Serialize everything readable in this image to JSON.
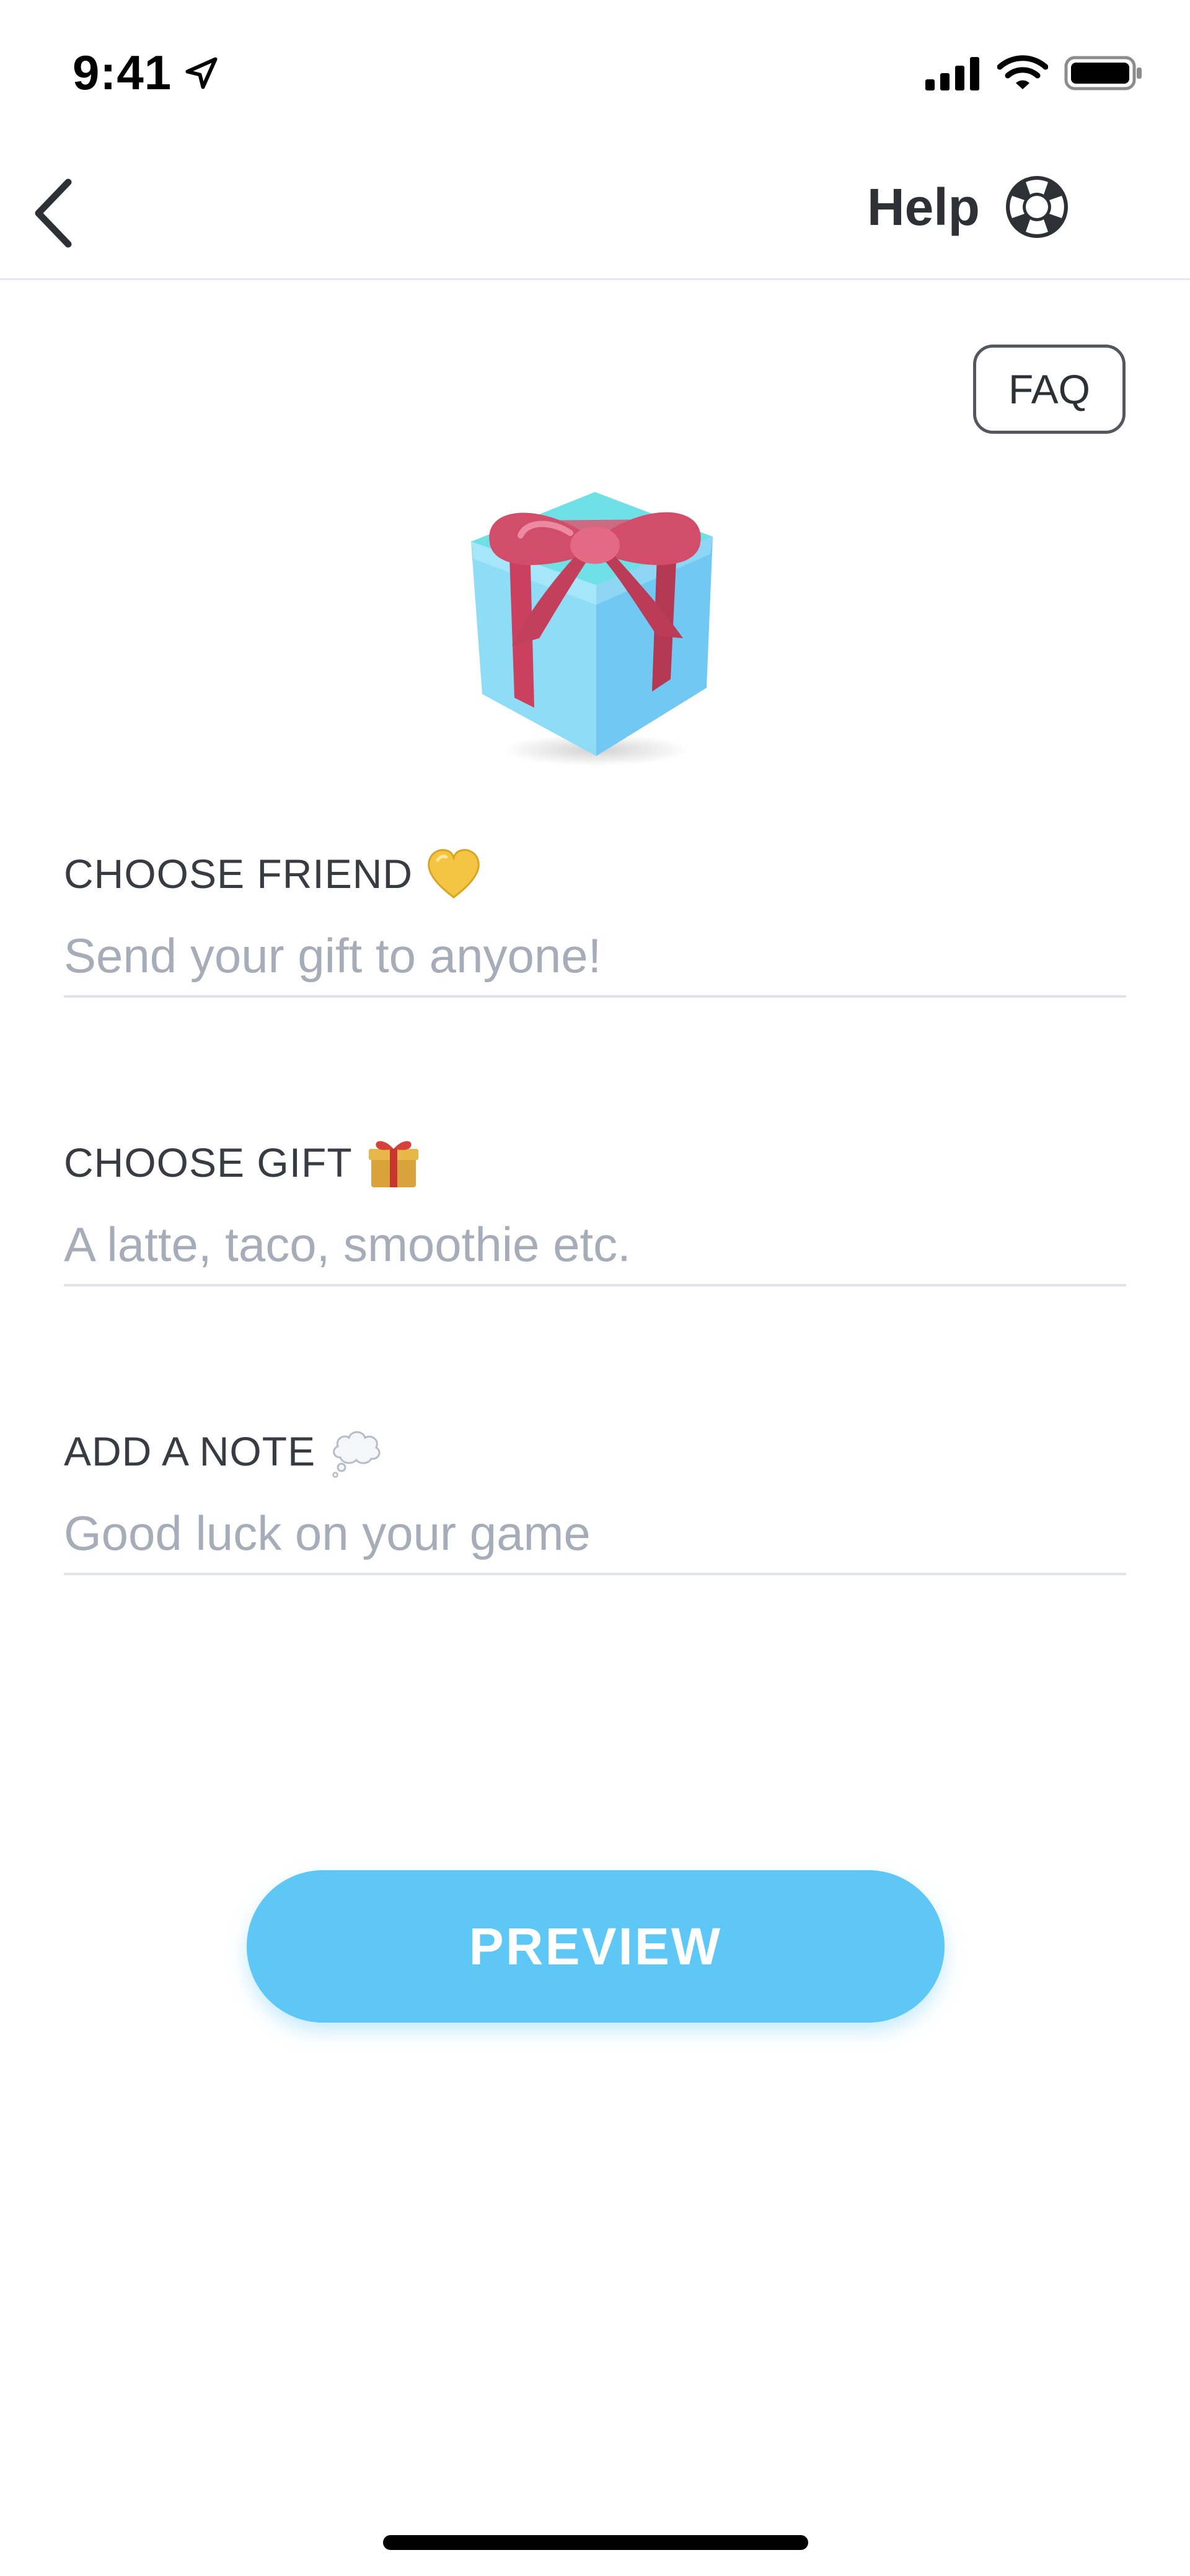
{
  "status_bar": {
    "time": "9:41",
    "icons": [
      "location-arrow-icon",
      "cellular-signal-icon",
      "wifi-icon",
      "battery-icon"
    ]
  },
  "nav": {
    "back_icon": "chevron-left-icon",
    "help_label": "Help",
    "help_icon": "lifebuoy-icon"
  },
  "faq": {
    "label": "FAQ"
  },
  "hero": {
    "icon": "gift-box-icon"
  },
  "form": {
    "friend": {
      "label": "CHOOSE FRIEND",
      "emoji_icon": "yellow-heart-icon",
      "placeholder": "Send your gift to anyone!",
      "value": ""
    },
    "gift": {
      "label": "CHOOSE GIFT",
      "emoji_icon": "wrapped-gift-icon",
      "placeholder": "A latte, taco, smoothie etc.",
      "value": ""
    },
    "note": {
      "label": "ADD A NOTE",
      "emoji_icon": "thought-bubble-icon",
      "placeholder": "Good luck on your game",
      "value": ""
    }
  },
  "preview_button": {
    "label": "PREVIEW"
  },
  "colors": {
    "accent": "#5ec7f6",
    "text": "#2f3036",
    "placeholder": "#a7acb9",
    "divider": "#e1e3ea"
  }
}
